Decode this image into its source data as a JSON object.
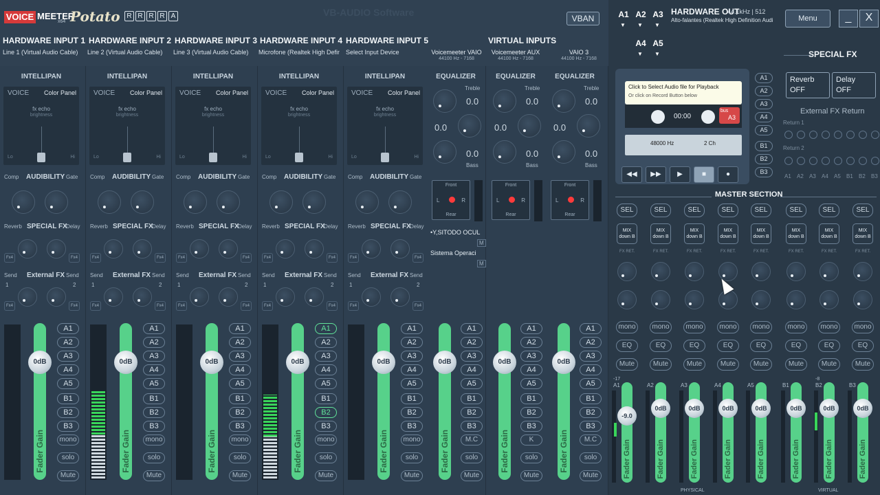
{
  "header": {
    "logo_voice": "VOICE",
    "logo_meeter": "MEETER",
    "logo_x64": "x64",
    "logo_potato": "Potato",
    "r_buttons": [
      "R",
      "R",
      "R",
      "R",
      "A"
    ],
    "vban": "VBAN",
    "watermark": "VB-AUDIO Software"
  },
  "hardware_inputs": [
    {
      "title": "HARDWARE INPUT 1",
      "device": "Line 1 (Virtual Audio Cable)"
    },
    {
      "title": "HARDWARE INPUT 2",
      "device": "Line 2 (Virtual Audio Cable)"
    },
    {
      "title": "HARDWARE INPUT 3",
      "device": "Line 3 (Virtual Audio Cable)"
    },
    {
      "title": "HARDWARE INPUT 4",
      "device": "Microfone (Realtek High Defini"
    },
    {
      "title": "HARDWARE INPUT 5",
      "device": "Select Input Device"
    }
  ],
  "virtual_inputs": {
    "title": "VIRTUAL INPUTS",
    "items": [
      {
        "name": "Voicemeeter VAIO",
        "sub": "44100 Hz - 7168"
      },
      {
        "name": "Voicemeeter AUX",
        "sub": "44100 Hz - 7168"
      },
      {
        "name": "VAIO 3",
        "sub": "44100 Hz - 7168"
      }
    ]
  },
  "strip_labels": {
    "intellipan": "INTELLIPAN",
    "voice": "VOICE",
    "color_panel": "Color Panel",
    "fx_echo": "fx echo",
    "brightness": "brightness",
    "lo": "Lo",
    "hi": "Hi",
    "comp": "Comp",
    "audibility": "AUDIBILITY",
    "gate": "Gate",
    "reverb": "Reverb",
    "special_fx": "SPECIAL FX",
    "delay": "Delay",
    "send": "Send",
    "external_fx": "External FX",
    "one": "1",
    "two": "2",
    "fader_gain": "Fader Gain",
    "db": "0dB",
    "mono": "mono",
    "solo": "solo",
    "mute": "Mute",
    "mc": "M.C",
    "k": "K",
    "equalizer": "EQUALIZER",
    "treble": "Treble",
    "bass": "Bass",
    "eq_value": "0.0",
    "front": "Front",
    "rear": "Rear",
    "l": "L",
    "r": "R",
    "fn": "Fx4"
  },
  "busses": [
    "A1",
    "A2",
    "A3",
    "A4",
    "A5",
    "B1",
    "B2",
    "B3"
  ],
  "active_busses": {
    "strip4": [
      "A1",
      "B2"
    ]
  },
  "apps": [
    {
      "name": "•Y,SITODO OCUL",
      "m": "M"
    },
    {
      "name": "Sistema Operaci",
      "m": "M"
    }
  ],
  "hardware_out": {
    "title": "HARDWARE OUT",
    "spec": "44.1kHz | 512",
    "device": "Alto-falantes (Realtek High Definition Audi",
    "a_buttons": [
      "A1",
      "A2",
      "A3",
      "A4",
      "A5"
    ],
    "menu": "Menu",
    "minimize": "_",
    "close": "X"
  },
  "player": {
    "prompt": "Click to Select Audio file for Playback",
    "hint": "Or click on Record Button below",
    "time": "00:00",
    "bus_label": "bus",
    "bus_value": "A3",
    "rate": "48000 Hz",
    "channels": "2 Ch",
    "side_busses": [
      "A1",
      "A2",
      "A3",
      "A4",
      "A5",
      "B1",
      "B2",
      "B3"
    ]
  },
  "special_fx_panel": {
    "title": "SPECIAL FX",
    "reverb": "Reverb",
    "reverb_state": "OFF",
    "delay": "Delay",
    "delay_state": "OFF",
    "ext_return": "External FX Return",
    "return1": "Return 1",
    "return2": "Return 2",
    "bus_row": [
      "A1",
      "A2",
      "A3",
      "A4",
      "A5",
      "B1",
      "B2",
      "B3"
    ]
  },
  "master": {
    "title": "MASTER SECTION",
    "sel": "SEL",
    "mix_down": "MIX down B",
    "fx_ret": "FX RET.",
    "mono": "mono",
    "eq": "EQ",
    "mute": "Mute",
    "channels": [
      "A1",
      "A2",
      "A3",
      "A4",
      "A5",
      "B1",
      "B2",
      "B3"
    ],
    "fader_values": [
      "-9.0",
      "0dB",
      "0dB",
      "0dB",
      "0dB",
      "0dB",
      "0dB",
      "0dB"
    ],
    "fader_label": "Fader Gain",
    "physical": "PHYSICAL",
    "virtual": "VIRTUAL",
    "level_m17": "-17",
    "level_m8": "-8"
  }
}
